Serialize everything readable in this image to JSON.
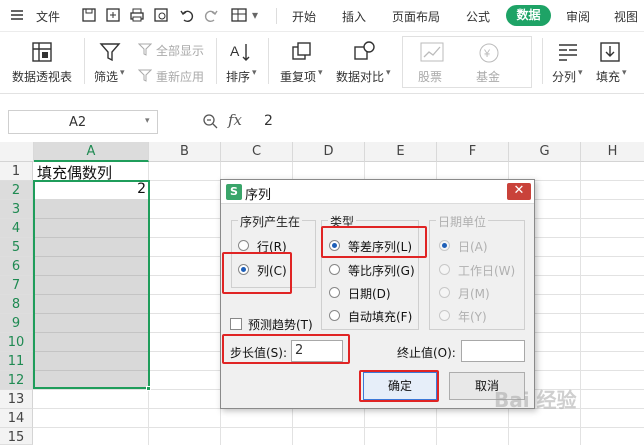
{
  "menubar": {
    "file": "文件",
    "tabs": [
      "开始",
      "插入",
      "页面布局",
      "公式",
      "数据",
      "审阅",
      "视图"
    ],
    "active_tab": "数据",
    "icons": [
      "hamburger-icon",
      "save-icon",
      "export-icon",
      "print-icon",
      "preview-icon",
      "undo-icon",
      "redo-icon",
      "format-icon",
      "more-icon"
    ]
  },
  "ribbon": {
    "pivot": "数据透视表",
    "filter": "筛选",
    "show_all": "全部显示",
    "reapply": "重新应用",
    "sort": "排序",
    "duplicates": "重复项",
    "compare": "数据对比",
    "stock": "股票",
    "fund": "基金",
    "split": "分列",
    "fill": "填充"
  },
  "formula_bar": {
    "name_box": "A2",
    "fx": "fx",
    "value": "2"
  },
  "sheet": {
    "columns": [
      "A",
      "B",
      "C",
      "D",
      "E",
      "F",
      "G",
      "H"
    ],
    "rows": [
      "1",
      "2",
      "3",
      "4",
      "5",
      "6",
      "7",
      "8",
      "9",
      "10",
      "11",
      "12",
      "13",
      "14",
      "15"
    ],
    "a1": "填充偶数列",
    "a2": "2"
  },
  "dialog": {
    "title": "序列",
    "series_in": {
      "title": "序列产生在",
      "row": "行(R)",
      "column": "列(C)"
    },
    "type": {
      "title": "类型",
      "linear": "等差序列(L)",
      "growth": "等比序列(G)",
      "date": "日期(D)",
      "autofill": "自动填充(F)"
    },
    "date_unit": {
      "title": "日期单位",
      "day": "日(A)",
      "weekday": "工作日(W)",
      "month": "月(M)",
      "year": "年(Y)"
    },
    "trend": "预测趋势(T)",
    "step_label": "步长值(S):",
    "step_value": "2",
    "stop_label": "终止值(O):",
    "stop_value": "",
    "ok": "确定",
    "cancel": "取消"
  },
  "watermark": "Bai 经验"
}
